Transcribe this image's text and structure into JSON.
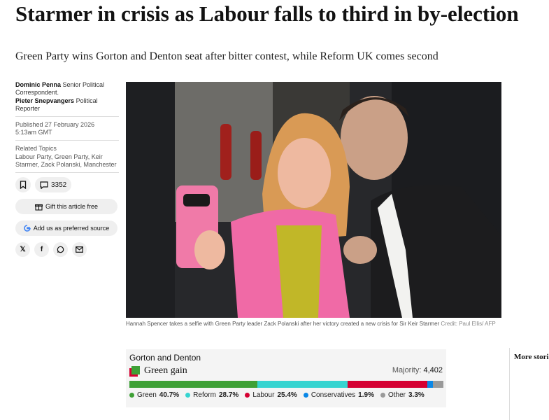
{
  "article": {
    "headline": "Starmer in crisis as Labour falls to third in by-election",
    "standfirst": "Green Party wins Gorton and Denton seat after bitter contest, while Reform UK comes second"
  },
  "byline": {
    "authors": [
      {
        "name": "Dominic Penna",
        "role": "Senior Political Correspondent."
      },
      {
        "name": "Pieter Snepvangers",
        "role": "Political Reporter"
      }
    ],
    "published": "Published 27 February 2026",
    "time": "5:13am GMT",
    "related_title": "Related Topics",
    "related_topics": "Labour Party, Green Party, Keir Starmer, Zack Polanski, Manchester",
    "comment_count": "3352",
    "gift_label": "Gift this article free",
    "google_label": "Add us as preferred source"
  },
  "share_icons": [
    "x-icon",
    "facebook-icon",
    "whatsapp-icon",
    "email-icon"
  ],
  "photo": {
    "caption": "Hannah Spencer takes a selfie with Green Party leader Zack Polanski after her victory created a new crisis for Sir Keir Starmer",
    "credit": "Credit: Paul Ellis/ AFP"
  },
  "results": {
    "seat": "Gorton and Denton",
    "gain": "Green gain",
    "majority_label": "Majority:",
    "majority_value": "4,402",
    "parties": [
      {
        "name": "Green",
        "share": "40.7%",
        "value": 40.7,
        "color": "#3ea036"
      },
      {
        "name": "Reform",
        "share": "28.7%",
        "value": 28.7,
        "color": "#36d4d0"
      },
      {
        "name": "Labour",
        "share": "25.4%",
        "value": 25.4,
        "color": "#d50032"
      },
      {
        "name": "Conservatives",
        "share": "1.9%",
        "value": 1.9,
        "color": "#0a87e6"
      },
      {
        "name": "Other",
        "share": "3.3%",
        "value": 3.3,
        "color": "#9a9a9a"
      }
    ]
  },
  "more_stories": "More stories"
}
